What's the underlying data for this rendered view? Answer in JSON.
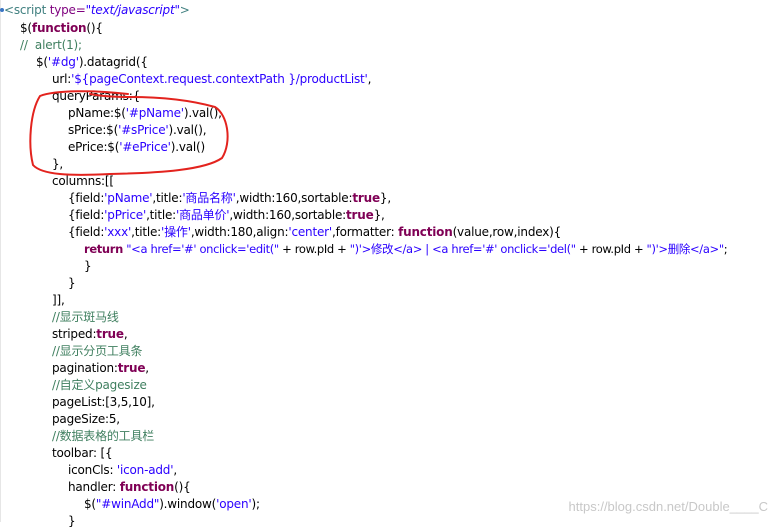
{
  "code": {
    "l1": {
      "open": "<",
      "tag": "script",
      "attr": "type=",
      "val": "\"text/javascript\"",
      "close": ">"
    },
    "l2": {
      "a": "$(",
      "kw": "function",
      "b": "(){"
    },
    "l3": {
      "cmt": "//  alert(1);"
    },
    "l4": {
      "a": "$(",
      "s": "'#dg'",
      "b": ").datagrid({"
    },
    "l5": {
      "a": "url:",
      "s": "'${pageContext.request.contextPath }/productList'",
      "b": ","
    },
    "l6": {
      "a": "queryParams:{"
    },
    "l7": {
      "a": "pName:$(",
      "s": "'#pName'",
      "b": ").val(),"
    },
    "l8": {
      "a": "sPrice:$(",
      "s": "'#sPrice'",
      "b": ").val(),"
    },
    "l9": {
      "a": "ePrice:$(",
      "s": "'#ePrice'",
      "b": ").val()"
    },
    "l10": {
      "a": "},"
    },
    "l11": {
      "a": "columns:[["
    },
    "l12": {
      "a": "{field:",
      "s1": "'pName'",
      "b": ",title:",
      "s2": "'商品名称'",
      "c": ",width:160,sortable:",
      "kw": "true",
      "d": "},"
    },
    "l13": {
      "a": "{field:",
      "s1": "'pPrice'",
      "b": ",title:",
      "s2": "'商品单价'",
      "c": ",width:160,sortable:",
      "kw": "true",
      "d": "},"
    },
    "l14": {
      "a": "{field:",
      "s1": "'xxx'",
      "b": ",title:",
      "s2": "'操作'",
      "c": ",width:180,align:",
      "s3": "'center'",
      "e": ",formatter: ",
      "kw": "function",
      "f": "(value,row,index){"
    },
    "l15": {
      "kw": "return",
      "s1": " \"<a href='#' onclick='edit(\"",
      "a": " + row.pId + ",
      "s2": "\")'>修改</a> | <a href='#' onclick='del(\"",
      "b": " + row.pId + ",
      "s3": "\")'>删除</a>\"",
      "c": ";"
    },
    "l16": {
      "a": "}"
    },
    "l17": {
      "a": "}"
    },
    "l18": {
      "a": "]],"
    },
    "l19": {
      "cmt": "//显示斑马线"
    },
    "l20": {
      "a": "striped:",
      "kw": "true",
      "b": ","
    },
    "l21": {
      "cmt": "//显示分页工具条"
    },
    "l22": {
      "a": "pagination:",
      "kw": "true",
      "b": ","
    },
    "l23": {
      "cmt": "//自定义pagesize"
    },
    "l24": {
      "a": "pageList:[3,5,10],"
    },
    "l25": {
      "a": "pageSize:5,"
    },
    "l26": {
      "cmt": "//数据表格的工具栏"
    },
    "l27": {
      "a": "toolbar: [{"
    },
    "l28": {
      "a": "iconCls: ",
      "s": "'icon-add'",
      "b": ","
    },
    "l29": {
      "a": "handler: ",
      "kw": "function",
      "b": "(){"
    },
    "l30": {
      "a": "$(",
      "s": "\"#winAdd\"",
      "b": ").window(",
      "s2": "'open'",
      "c": ");"
    },
    "l31": {
      "a": "}"
    }
  },
  "watermark": "https://blog.csdn.net/Double____C",
  "colors": {
    "keyword": "#7f0055",
    "string": "#2a00ff",
    "comment": "#3f7f5f",
    "annotation": "#e3231e"
  }
}
